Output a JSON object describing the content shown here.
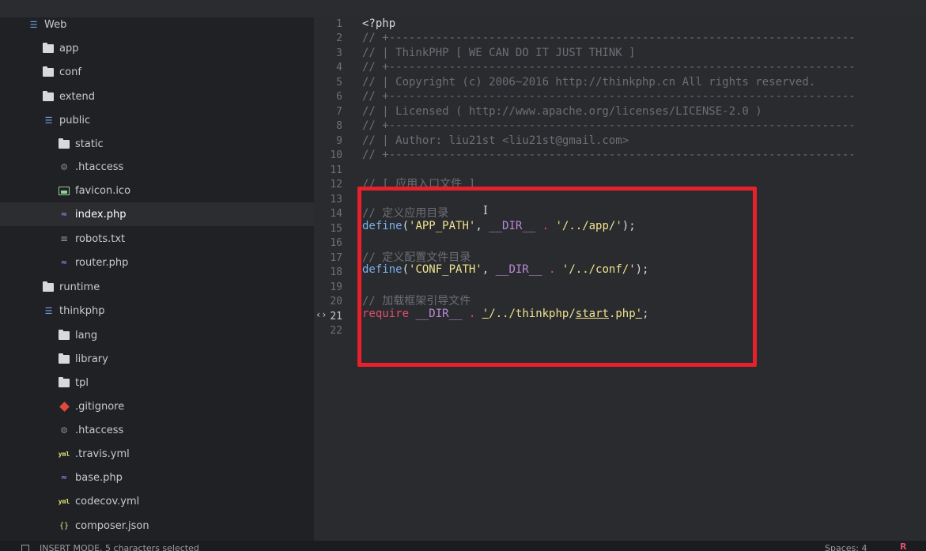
{
  "sidebar": {
    "items": [
      {
        "label": "Web",
        "icon": "folder-open-icon"
      },
      {
        "label": "app",
        "icon": "folder-icon"
      },
      {
        "label": "conf",
        "icon": "folder-icon"
      },
      {
        "label": "extend",
        "icon": "folder-icon"
      },
      {
        "label": "public",
        "icon": "folder-open-icon"
      },
      {
        "label": "static",
        "icon": "folder-icon"
      },
      {
        "label": ".htaccess",
        "icon": "gear-file-icon"
      },
      {
        "label": "favicon.ico",
        "icon": "image-file-icon"
      },
      {
        "label": "index.php",
        "icon": "php-file-icon"
      },
      {
        "label": "robots.txt",
        "icon": "text-file-icon"
      },
      {
        "label": "router.php",
        "icon": "php-file-icon"
      },
      {
        "label": "runtime",
        "icon": "folder-icon"
      },
      {
        "label": "thinkphp",
        "icon": "folder-open-icon"
      },
      {
        "label": "lang",
        "icon": "folder-icon"
      },
      {
        "label": "library",
        "icon": "folder-icon"
      },
      {
        "label": "tpl",
        "icon": "folder-icon"
      },
      {
        "label": ".gitignore",
        "icon": "git-file-icon"
      },
      {
        "label": ".htaccess",
        "icon": "gear-file-icon"
      },
      {
        "label": ".travis.yml",
        "icon": "yml-file-icon"
      },
      {
        "label": "base.php",
        "icon": "php-file-icon"
      },
      {
        "label": "codecov.yml",
        "icon": "yml-file-icon"
      },
      {
        "label": "composer.json",
        "icon": "json-file-icon"
      }
    ]
  },
  "editor": {
    "line_numbers": [
      "1",
      "2",
      "3",
      "4",
      "5",
      "6",
      "7",
      "8",
      "9",
      "10",
      "11",
      "12",
      "13",
      "14",
      "15",
      "16",
      "17",
      "18",
      "19",
      "20",
      "21",
      "22"
    ],
    "lines": {
      "l1": "<?php",
      "l2": "// +----------------------------------------------------------------------",
      "l3": "// | ThinkPHP [ WE CAN DO IT JUST THINK ]",
      "l4": "// +----------------------------------------------------------------------",
      "l5": "// | Copyright (c) 2006~2016 http://thinkphp.cn All rights reserved.",
      "l6": "// +----------------------------------------------------------------------",
      "l7": "// | Licensed ( http://www.apache.org/licenses/LICENSE-2.0 )",
      "l8": "// +----------------------------------------------------------------------",
      "l9": "// | Author: liu21st <liu21st@gmail.com>",
      "l10": "// +----------------------------------------------------------------------",
      "l12": "// [ 应用入口文件 ]",
      "l14": "// 定义应用目录",
      "l15": {
        "fn": "define",
        "open": "(",
        "str1": "'APP_PATH'",
        "comma": ", ",
        "var": "__DIR__",
        "dot": " . ",
        "str2": "'/../app/'",
        "close": ");"
      },
      "l17": "// 定义配置文件目录",
      "l18": {
        "fn": "define",
        "open": "(",
        "str1": "'CONF_PATH'",
        "comma": ", ",
        "var": "__DIR__",
        "dot": " . ",
        "str2": "'/../conf/'",
        "close": ");"
      },
      "l20": "// 加载框架引导文件",
      "l21": {
        "kw": "require",
        "var": "__DIR__",
        "dot": " . ",
        "q1": "'",
        "path": "/../thinkphp/",
        "start": "start",
        "ext": ".php",
        "q2": "'",
        "semi": ";"
      }
    },
    "gutter_marker": "‹›",
    "cursor_glyph": "I"
  },
  "status": {
    "mode_text": "INSERT MODE, 5 characters selected",
    "spaces": "Spaces: 4",
    "right_mark": "R"
  },
  "colors": {
    "highlight_box": "#e8202a",
    "string": "#f0e38c",
    "function": "#7aaeea",
    "keyword": "#e04e6e",
    "variable": "#b88ad6",
    "comment": "#6b6e73"
  }
}
